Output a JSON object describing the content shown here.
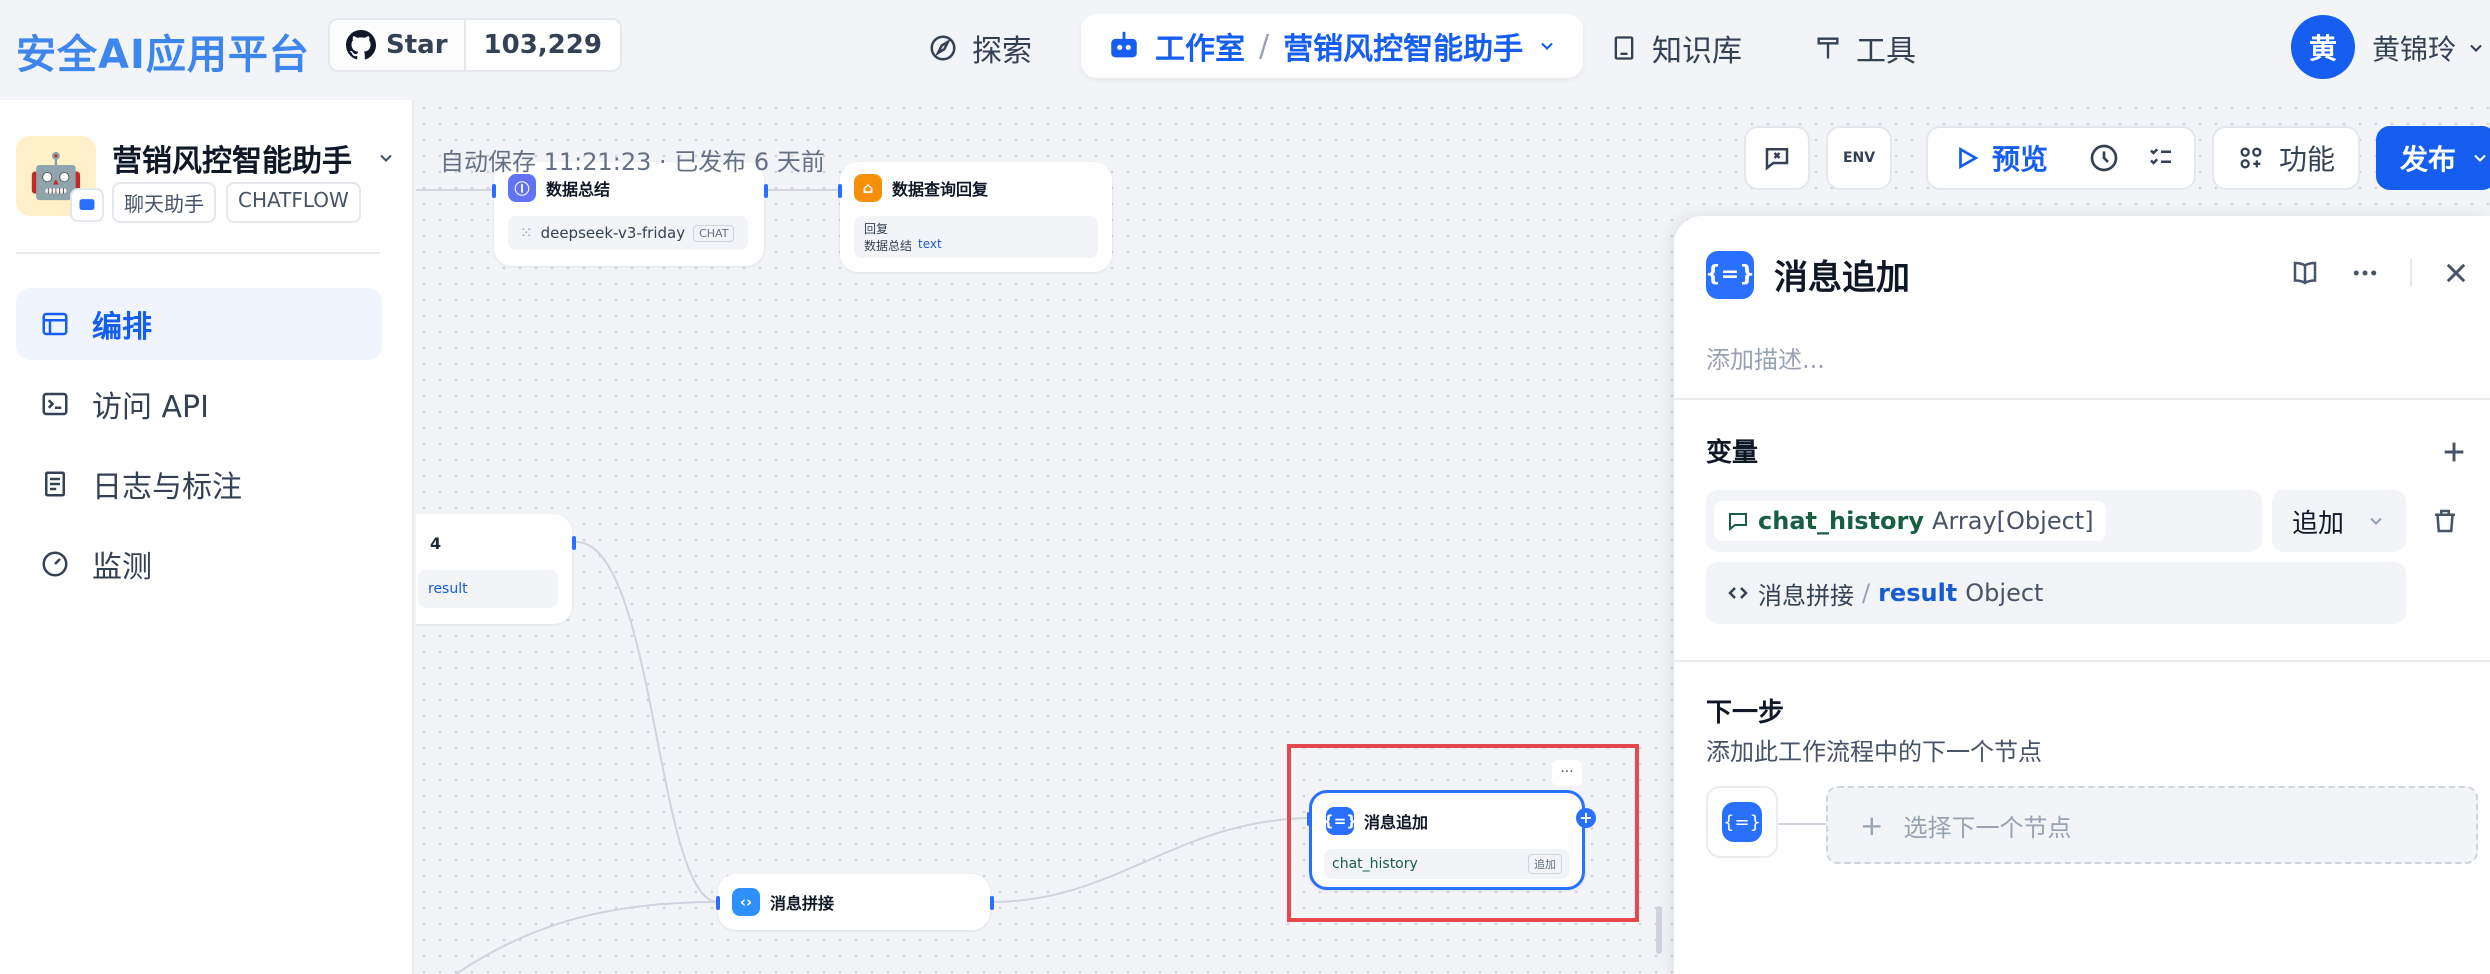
{
  "brand": "安全AI应用平台",
  "github": {
    "star_label": "Star",
    "star_count": "103,229"
  },
  "nav": {
    "explore": "探索",
    "studio": "工作室",
    "separator": "/",
    "current_app": "营销风控智能助手",
    "knowledge": "知识库",
    "tools": "工具"
  },
  "user": {
    "avatar_initial": "黄",
    "name": "黄锦玲"
  },
  "sidebar": {
    "app_name": "营销风控智能助手",
    "tags": [
      "聊天助手",
      "CHATFLOW"
    ],
    "items": [
      {
        "label": "编排",
        "icon": "layout-icon",
        "active": true
      },
      {
        "label": "访问 API",
        "icon": "terminal-icon"
      },
      {
        "label": "日志与标注",
        "icon": "log-icon"
      },
      {
        "label": "监测",
        "icon": "gauge-icon"
      }
    ]
  },
  "canvas": {
    "autosave": "自动保存 11:21:23 · 已发布 6 天前",
    "nodes": {
      "summary": {
        "title": "数据总结",
        "model": "deepseek-v3-friday",
        "model_tag": "CHAT"
      },
      "reply": {
        "title": "数据查询回复",
        "label": "回复",
        "source": "数据总结",
        "var": "text"
      },
      "partial": {
        "title_fragment": "4",
        "var": "result"
      },
      "concat": {
        "title": "消息拼接"
      },
      "append": {
        "title": "消息追加",
        "var": "chat_history",
        "tag": "追加",
        "more": "···"
      }
    }
  },
  "toolbar": {
    "env_label": "ENV",
    "preview": "预览",
    "features": "功能",
    "publish": "发布"
  },
  "panel": {
    "title": "消息追加",
    "desc_placeholder": "添加描述...",
    "var_section": "变量",
    "var_name": "chat_history",
    "var_type": "Array[Object]",
    "mode": "追加",
    "source_node": "消息拼接",
    "source_sep": "/",
    "source_var": "result",
    "source_type": "Object",
    "next_title": "下一步",
    "next_desc": "添加此工作流程中的下一个节点",
    "next_select": "选择下一个节点",
    "plus": "+"
  }
}
